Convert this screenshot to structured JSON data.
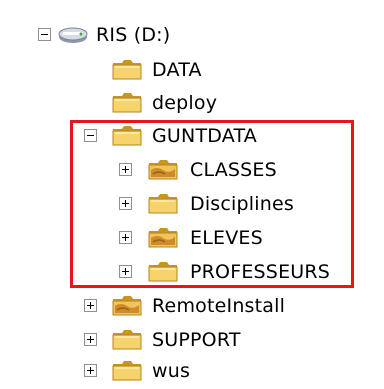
{
  "tree": {
    "root": {
      "label": "RIS (D:)",
      "icon": "drive-icon",
      "expanded": true
    },
    "nodes": [
      {
        "label": "DATA",
        "icon": "folder-icon",
        "expander": "none"
      },
      {
        "label": "deploy",
        "icon": "folder-icon",
        "expander": "none"
      },
      {
        "label": "GUNTDATA",
        "icon": "folder-icon",
        "expander": "minus"
      },
      {
        "label": "CLASSES",
        "icon": "shared-folder-icon",
        "expander": "plus"
      },
      {
        "label": "Disciplines",
        "icon": "folder-icon",
        "expander": "plus"
      },
      {
        "label": "ELEVES",
        "icon": "shared-folder-icon",
        "expander": "plus"
      },
      {
        "label": "PROFESSEURS",
        "icon": "folder-icon",
        "expander": "plus"
      },
      {
        "label": "RemoteInstall",
        "icon": "shared-folder-icon",
        "expander": "plus"
      },
      {
        "label": "SUPPORT",
        "icon": "folder-icon",
        "expander": "plus"
      },
      {
        "label": "wus",
        "icon": "folder-icon",
        "expander": "plus"
      }
    ]
  },
  "colors": {
    "highlight": "#e8141c",
    "folder_fill": "#f7d36b",
    "folder_dark": "#c8961f",
    "expander_border": "#8f8f8f"
  }
}
